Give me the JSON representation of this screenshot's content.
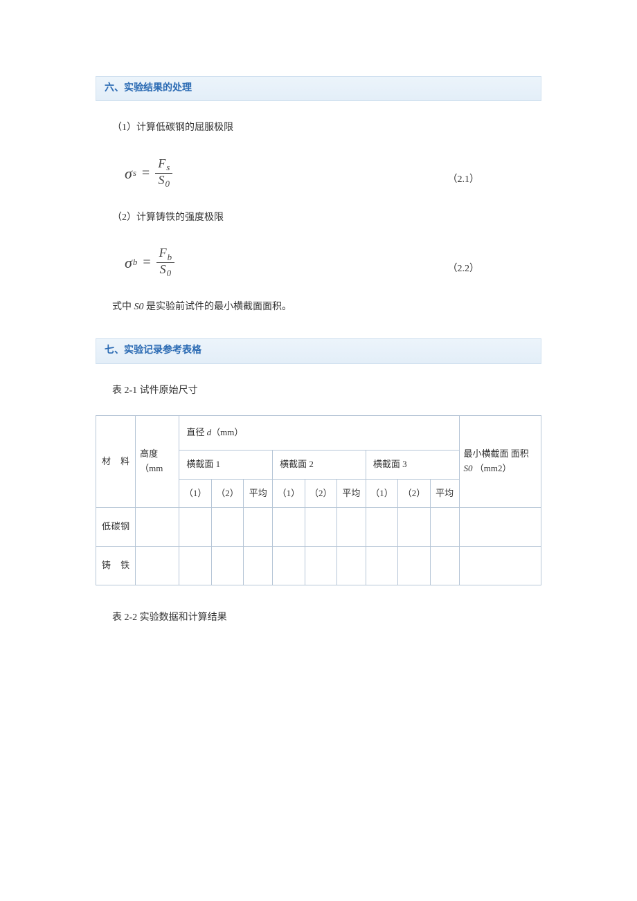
{
  "section6": {
    "title": "六、实验结果的处理",
    "item1": "（1）计算低碳钢的屈服极限",
    "eq1": {
      "lhs_sigma": "σ",
      "lhs_sub": "s",
      "equals": "=",
      "num_var": "F",
      "num_sub": "s",
      "den_var": "S",
      "den_sub": "0",
      "number": "（2.1）"
    },
    "item2": "（2）计算铸铁的强度极限",
    "eq2": {
      "lhs_sigma": "σ",
      "lhs_sub": "b",
      "equals": "=",
      "num_var": "F",
      "num_sub": "b",
      "den_var": "S",
      "den_sub": "0",
      "number": "（2.2）"
    },
    "note_prefix": "式中 ",
    "note_var": "S0",
    "note_suffix": " 是实验前试件的最小横截面面积。"
  },
  "section7": {
    "title": "七、实验记录参考表格",
    "table1_caption": "表 2-1 试件原始尺寸",
    "table1_headers": {
      "material": "材  料",
      "height": "高度 （mm",
      "diameter_prefix": "直径 ",
      "diameter_var": "d",
      "diameter_unit": "（mm）",
      "section1": "横截面 1",
      "section2": "横截面 2",
      "section3": "横截面 3",
      "area_prefix": "最小横截面 面积 ",
      "area_var": "S0",
      "area_unit": " （mm2）",
      "col1": "（1）",
      "col2": "（2）",
      "avg": "平均"
    },
    "table1_rows": {
      "row1_material": "低碳钢",
      "row2_material": "铸  铁"
    },
    "table2_caption": "表 2-2 实验数据和计算结果"
  }
}
